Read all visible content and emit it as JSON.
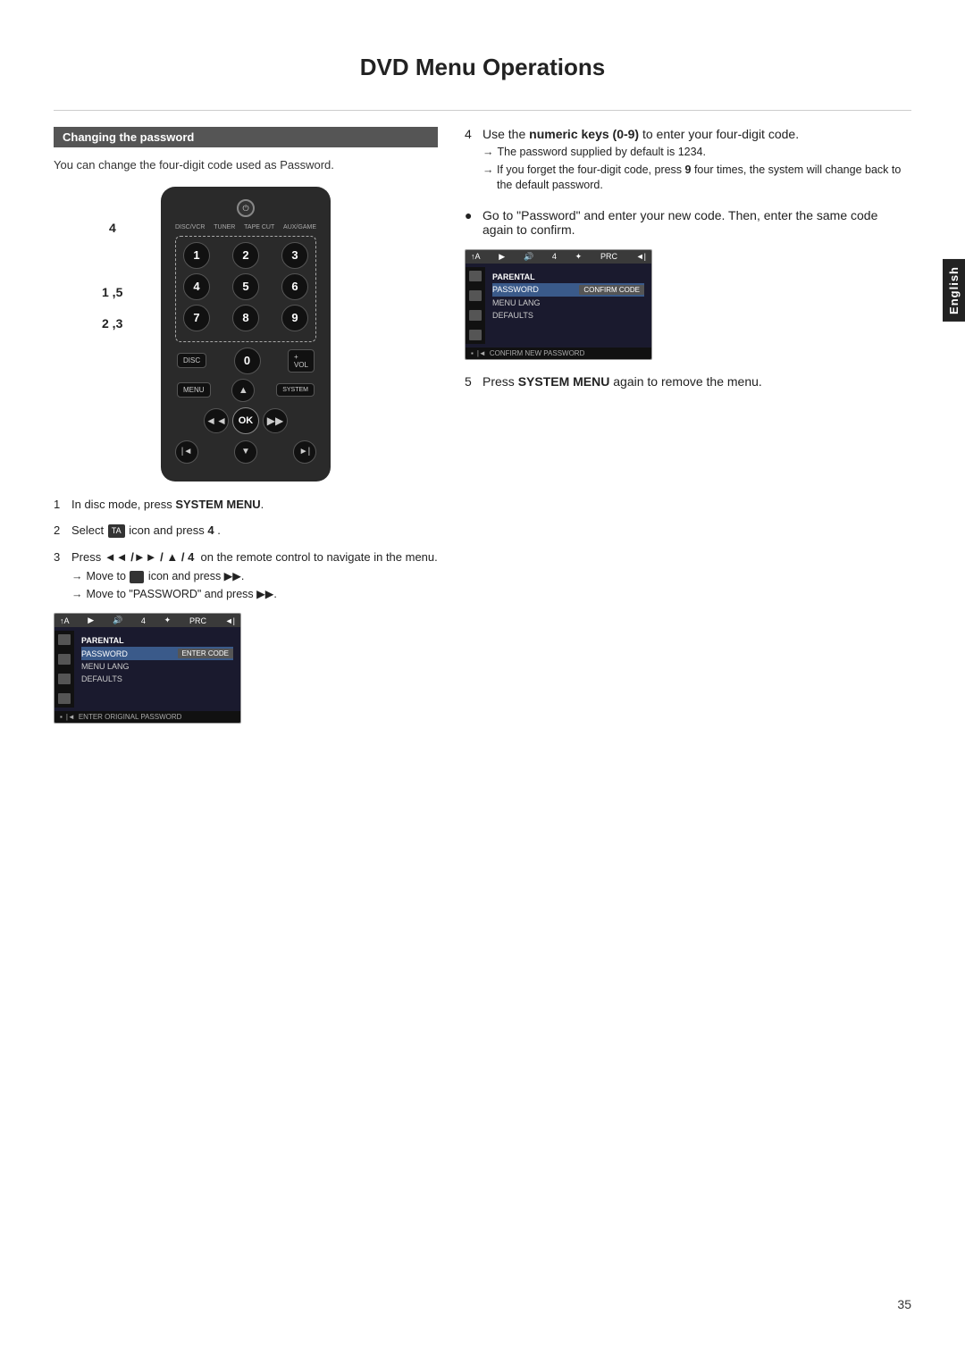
{
  "page": {
    "title": "DVD Menu Operations",
    "page_number": "35",
    "language_tab": "English"
  },
  "section": {
    "header": "Changing the password",
    "description": "You can change the four-digit code used as Password."
  },
  "remote": {
    "label_4": "4",
    "label_1_5": "1 ,5",
    "label_2_3": "2 ,3",
    "source_labels": [
      "DISC/VCR",
      "TUNER",
      "TAPE CUT",
      "AUX/GAME"
    ]
  },
  "steps_left": [
    {
      "num": "1",
      "text": "In disc mode, press ",
      "bold": "SYSTEM MENU",
      "rest": "."
    },
    {
      "num": "2",
      "text": "Select ",
      "icon": "TA",
      "text2": " icon and press ",
      "bold": "4",
      "rest": " ."
    },
    {
      "num": "3",
      "text": "Press ",
      "bold": "◄◄ / ►► / ▲ / 4",
      "rest": "  on the remote control to navigate in the menu.",
      "sub": [
        "→ Move to  icon and press ►►.",
        "→ Move to \"PASSWORD\" and press ►►."
      ]
    }
  ],
  "menu_bottom_label_1": "ENTER ORIGINAL PASSWORD",
  "menu_items_1": [
    "PARENTAL",
    "PASSWORD",
    "MENU LANG",
    "DEFAULTS"
  ],
  "menu_enter_code": "ENTER CODE",
  "steps_right": [
    {
      "num": "4",
      "text": "Use the ",
      "bold": "numeric keys (0-9)",
      "rest": " to enter your four-digit code.",
      "sub": [
        "→ The password supplied by default is 1234.",
        "→ If you forget the four-digit code, press 9 four times, the system will change back to the default password."
      ]
    },
    {
      "num": "●",
      "text": "Go to \"Password\" and enter your new code. Then, enter the same code again to confirm."
    },
    {
      "num": "5",
      "text": "Press ",
      "bold": "SYSTEM MENU",
      "rest": " again to remove the menu."
    }
  ],
  "menu_items_2": [
    "PARENTAL",
    "PASSWORD",
    "MENU LANG",
    "DEFAULTS"
  ],
  "menu_confirm_code": "CONFIRM CODE",
  "menu_bottom_label_2": "CONFIRM NEW PASSWORD"
}
